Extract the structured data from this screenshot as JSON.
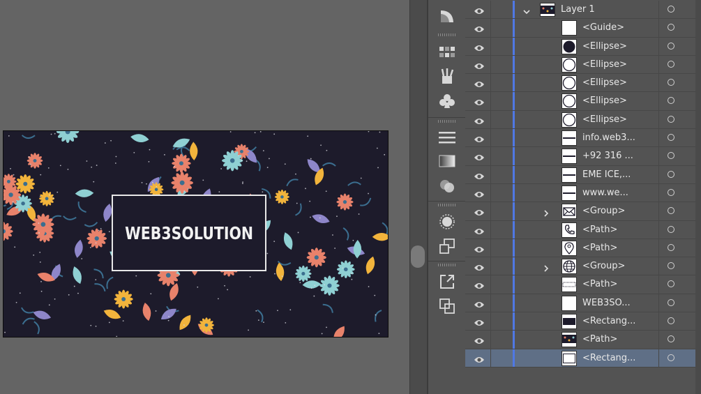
{
  "artboard": {
    "brand_text": "WEB3SOLUTION",
    "colors": {
      "background": "#1d1b2b",
      "petal_coral": "#e8826b",
      "petal_yellow": "#f2b43c",
      "petal_lilac": "#8e86c9",
      "leaf_teal": "#8fd0d3",
      "leaf_blue": "#3b6e8f"
    }
  },
  "tools": [
    {
      "icon": "graphic-styles-icon"
    },
    {
      "icon": "swatches-grid-icon"
    },
    {
      "icon": "brushes-icon"
    },
    {
      "icon": "symbols-club-icon"
    },
    {
      "icon": "align-lines-icon"
    },
    {
      "icon": "gradient-icon"
    },
    {
      "icon": "transparency-icon"
    },
    {
      "icon": "appearance-sun-icon"
    },
    {
      "icon": "transform-icon"
    },
    {
      "icon": "export-icon"
    },
    {
      "icon": "pathfinder-icon"
    }
  ],
  "layers": {
    "rows": [
      {
        "name": "Layer 1",
        "kind": "layer",
        "expanded": true,
        "thumb": "pattern"
      },
      {
        "name": "<Guide>",
        "thumb": "blank"
      },
      {
        "name": "<Ellipse>",
        "thumb": "ellipse-filled"
      },
      {
        "name": "<Ellipse>",
        "thumb": "ellipse"
      },
      {
        "name": "<Ellipse>",
        "thumb": "ellipse"
      },
      {
        "name": "<Ellipse>",
        "thumb": "ellipse"
      },
      {
        "name": "<Ellipse>",
        "thumb": "ellipse"
      },
      {
        "name": "info.web3...",
        "thumb": "text"
      },
      {
        "name": "+92 316 ...",
        "thumb": "text"
      },
      {
        "name": "EME ICE,...",
        "thumb": "text"
      },
      {
        "name": "www.we...",
        "thumb": "text"
      },
      {
        "name": "<Group>",
        "thumb": "mail",
        "collapsed_group": true
      },
      {
        "name": "<Path>",
        "thumb": "phone"
      },
      {
        "name": "<Path>",
        "thumb": "pin"
      },
      {
        "name": "<Group>",
        "thumb": "globe",
        "collapsed_group": true
      },
      {
        "name": "<Path>",
        "thumb": "dots"
      },
      {
        "name": "WEB3SO...",
        "thumb": "blank"
      },
      {
        "name": "<Rectang...",
        "thumb": "rect-dark"
      },
      {
        "name": "<Path>",
        "thumb": "pattern"
      },
      {
        "name": "<Rectang...",
        "thumb": "rect-outline",
        "selected": true
      }
    ]
  }
}
